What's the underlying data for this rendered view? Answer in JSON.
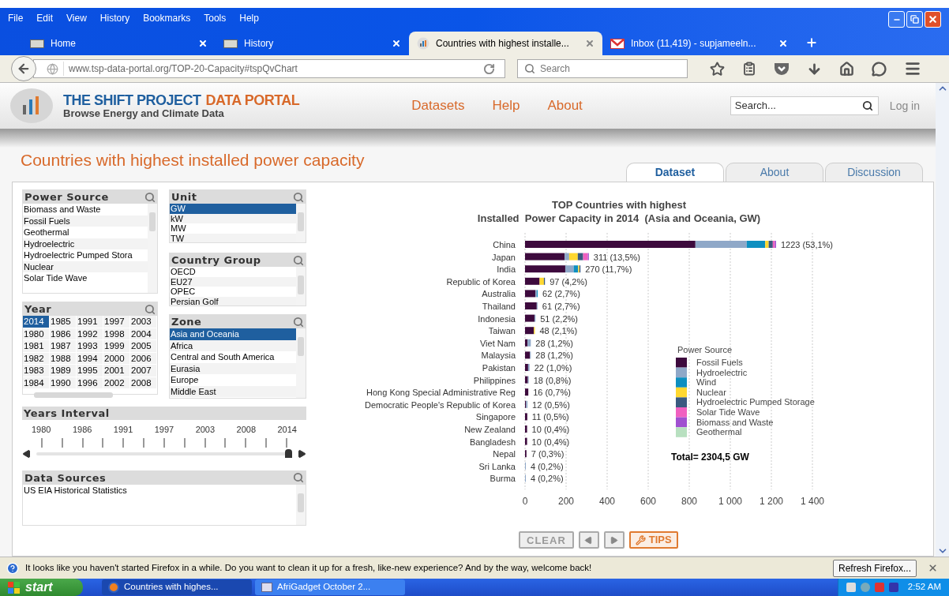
{
  "browser": {
    "menu": [
      "File",
      "Edit",
      "View",
      "History",
      "Bookmarks",
      "Tools",
      "Help"
    ],
    "tabs": [
      {
        "label": "Home",
        "selected": false,
        "kind": "page"
      },
      {
        "label": "History",
        "selected": false,
        "kind": "page"
      },
      {
        "label": "Countries with highest installe...",
        "selected": true,
        "kind": "chart"
      },
      {
        "label": "Inbox (11,419) - supjameeln...",
        "selected": false,
        "kind": "mail"
      }
    ],
    "address": "www.tsp-data-portal.org/TOP-20-Capacity#tspQvChart",
    "search_placeholder": "Search"
  },
  "site": {
    "brand_main": "THE SHIFT PROJECT",
    "brand_accent": "DATA PORTAL",
    "tagline": "Browse Energy and Climate Data",
    "nav": [
      "Datasets",
      "Help",
      "About"
    ],
    "search_placeholder": "Search...",
    "login": "Log in"
  },
  "page": {
    "title": "Countries with highest installed power capacity",
    "tabs": [
      {
        "label": "Dataset",
        "selected": true
      },
      {
        "label": "About",
        "selected": false
      },
      {
        "label": "Discussion",
        "selected": false
      }
    ]
  },
  "filters": {
    "power_source": {
      "title": "Power Source",
      "items": [
        {
          "label": "Biomass and Waste",
          "selected": false
        },
        {
          "label": "Fossil Fuels",
          "selected": false
        },
        {
          "label": "Geothermal",
          "selected": false
        },
        {
          "label": "Hydroelectric",
          "selected": false
        },
        {
          "label": "Hydroelectric Pumped Stora",
          "selected": false
        },
        {
          "label": "Nuclear",
          "selected": false
        },
        {
          "label": "Solar Tide Wave",
          "selected": false
        }
      ]
    },
    "unit": {
      "title": "Unit",
      "items": [
        {
          "label": "GW",
          "selected": true
        },
        {
          "label": "kW",
          "selected": false
        },
        {
          "label": "MW",
          "selected": false
        },
        {
          "label": "TW",
          "selected": false
        }
      ]
    },
    "country_group": {
      "title": "Country Group",
      "items": [
        {
          "label": "OECD",
          "selected": false
        },
        {
          "label": "EU27",
          "selected": false
        },
        {
          "label": "OPEC",
          "selected": false
        },
        {
          "label": "Persian Golf",
          "selected": false
        }
      ]
    },
    "year": {
      "title": "Year",
      "items": [
        {
          "label": "2014",
          "selected": true
        },
        {
          "label": "1980",
          "selected": false
        },
        {
          "label": "1981",
          "selected": false
        },
        {
          "label": "1982",
          "selected": false
        },
        {
          "label": "1983",
          "selected": false
        },
        {
          "label": "1984",
          "selected": false
        },
        {
          "label": "1985",
          "selected": false
        },
        {
          "label": "1986",
          "selected": false
        },
        {
          "label": "1987",
          "selected": false
        },
        {
          "label": "1988",
          "selected": false
        },
        {
          "label": "1989",
          "selected": false
        },
        {
          "label": "1990",
          "selected": false
        },
        {
          "label": "1991",
          "selected": false
        },
        {
          "label": "1992",
          "selected": false
        },
        {
          "label": "1993",
          "selected": false
        },
        {
          "label": "1994",
          "selected": false
        },
        {
          "label": "1995",
          "selected": false
        },
        {
          "label": "1996",
          "selected": false
        },
        {
          "label": "1997",
          "selected": false
        },
        {
          "label": "1998",
          "selected": false
        },
        {
          "label": "1999",
          "selected": false
        },
        {
          "label": "2000",
          "selected": false
        },
        {
          "label": "2001",
          "selected": false
        },
        {
          "label": "2002",
          "selected": false
        },
        {
          "label": "2003",
          "selected": false
        },
        {
          "label": "2004",
          "selected": false
        },
        {
          "label": "2005",
          "selected": false
        },
        {
          "label": "2006",
          "selected": false
        },
        {
          "label": "2007",
          "selected": false
        },
        {
          "label": "2008",
          "selected": false
        }
      ]
    },
    "zone": {
      "title": "Zone",
      "items": [
        {
          "label": "Asia and Oceania",
          "selected": true
        },
        {
          "label": "Africa",
          "selected": false
        },
        {
          "label": "Central and South America",
          "selected": false
        },
        {
          "label": "Eurasia",
          "selected": false
        },
        {
          "label": "Europe",
          "selected": false
        },
        {
          "label": "Middle East",
          "selected": false
        }
      ]
    },
    "years_interval": {
      "title": "Years Interval",
      "ticks": [
        "1980",
        "1986",
        "1991",
        "1997",
        "2003",
        "2008",
        "2014"
      ],
      "level": 1
    },
    "data_sources": {
      "title": "Data Sources",
      "items": [
        {
          "label": "US EIA Historical Statistics",
          "selected": false
        }
      ]
    }
  },
  "chart": {
    "legend_title": "Power Source",
    "total": "Total= 2304,5 GW",
    "chart_data": {
      "type": "bar",
      "orientation": "horizontal",
      "stacked": true,
      "title": "TOP Countries with highest\nInstalled  Power Capacity in 2014  (Asia and Oceania, GW)",
      "categories": [
        "China",
        "Japan",
        "India",
        "Republic of Korea",
        "Australia",
        "Thailand",
        "Indonesia",
        "Taiwan",
        "Viet Nam",
        "Malaysia",
        "Pakistan",
        "Philippines",
        "Hong Kong Special Administrative Reg",
        "Democratic People's Republic of Korea",
        "Singapore",
        "New Zealand",
        "Bangladesh",
        "Nepal",
        "Sri Lanka",
        "Burma"
      ],
      "series": [
        {
          "name": "Fossil Fuels",
          "color": "#3d0a3d",
          "values": [
            830,
            193,
            196,
            71,
            50,
            57,
            46,
            43,
            12,
            24,
            15,
            14,
            16,
            5,
            11,
            10,
            10,
            7,
            0,
            0
          ]
        },
        {
          "name": "Hydroelectric",
          "color": "#8fa8c8",
          "values": [
            250,
            22,
            41,
            0,
            8,
            4,
            5,
            0,
            16,
            4,
            7,
            4,
            0,
            7,
            0,
            0,
            0,
            0,
            4,
            4
          ]
        },
        {
          "name": "Wind",
          "color": "#0e8fc0",
          "values": [
            90,
            0,
            22,
            0,
            4,
            0,
            0,
            0,
            0,
            0,
            0,
            0,
            0,
            0,
            0,
            0,
            0,
            0,
            0,
            0
          ]
        },
        {
          "name": "Nuclear",
          "color": "#ffd830",
          "values": [
            17,
            42,
            6,
            21,
            0,
            0,
            0,
            5,
            0,
            0,
            0,
            0,
            0,
            0,
            0,
            0,
            0,
            0,
            0,
            0
          ]
        },
        {
          "name": "Hydroelectric Pumped Storage",
          "color": "#3a5a80",
          "values": [
            20,
            26,
            5,
            5,
            0,
            0,
            0,
            0,
            0,
            0,
            0,
            0,
            0,
            0,
            0,
            0,
            0,
            0,
            0,
            0
          ]
        },
        {
          "name": "Solar Tide Wave",
          "color": "#f060c0",
          "values": [
            10,
            23,
            0,
            0,
            0,
            0,
            0,
            0,
            0,
            0,
            0,
            0,
            0,
            0,
            0,
            0,
            0,
            0,
            0,
            0
          ]
        },
        {
          "name": "Biomass and Waste",
          "color": "#a050d0",
          "values": [
            6,
            5,
            0,
            0,
            0,
            0,
            0,
            0,
            0,
            0,
            0,
            0,
            0,
            0,
            0,
            0,
            0,
            0,
            0,
            0
          ]
        },
        {
          "name": "Geothermal",
          "color": "#b8e0c0",
          "values": [
            0,
            0,
            0,
            0,
            0,
            0,
            0,
            0,
            0,
            0,
            0,
            0,
            0,
            0,
            0,
            0,
            0,
            0,
            0,
            0
          ]
        }
      ],
      "grid": true,
      "legend": true,
      "xlim": [
        0,
        1400
      ],
      "value_labels": [
        "1223 (53,1%)",
        "311 (13,5%)",
        "270 (11,7%)",
        "97 (4,2%)",
        "62 (2,7%)",
        "61 (2,7%)",
        "51 (2,2%)",
        "48 (2,1%)",
        "28 (1,2%)",
        "28 (1,2%)",
        "22 (1,0%)",
        "18 (0,8%)",
        "16 (0,7%)",
        "12 (0,5%)",
        "11 (0,5%)",
        "10 (0,4%)",
        "10 (0,4%)",
        "7 (0,3%)",
        "4 (0,2%)",
        "4 (0,2%)"
      ],
      "xticks": [
        {
          "value": 0,
          "label": "0"
        },
        {
          "value": 200,
          "label": "200"
        },
        {
          "value": 400,
          "label": "400"
        },
        {
          "value": 600,
          "label": "600"
        },
        {
          "value": 800,
          "label": "800"
        },
        {
          "value": 1000,
          "label": "1 000"
        },
        {
          "value": 1200,
          "label": "1 200"
        },
        {
          "value": 1400,
          "label": "1 400"
        }
      ]
    }
  },
  "buttons": [
    {
      "kind": "clear",
      "label": "CLEAR"
    },
    {
      "kind": "prev"
    },
    {
      "kind": "next"
    },
    {
      "kind": "tips",
      "label": "TIPS"
    }
  ],
  "notification": {
    "text": "It looks like you haven't started Firefox in a while. Do you want to clean it up for a fresh, like-new experience? And by the way, welcome back!",
    "button": "Refresh Firefox..."
  },
  "taskbar": {
    "start": "start",
    "tasks": [
      {
        "label": "Countries with highes...",
        "selected": true,
        "kind": "firefox"
      },
      {
        "label": "AfriGadget October 2...",
        "selected": false,
        "kind": "doc"
      }
    ],
    "clock": "2:52 AM"
  }
}
